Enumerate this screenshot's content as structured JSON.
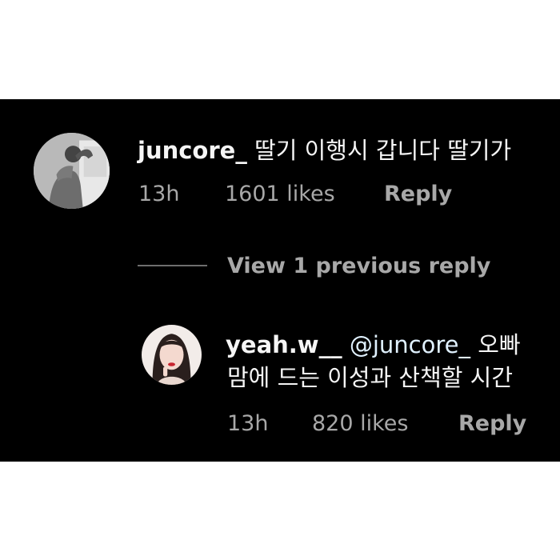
{
  "comments": [
    {
      "username": "juncore_",
      "text": "딸기 이행시 갑니다 딸기가",
      "time": "13h",
      "likes": "1601 likes",
      "reply_label": "Reply",
      "avatar_icon": "profile-photo"
    }
  ],
  "view_previous": "View 1 previous reply",
  "replies": [
    {
      "username": "yeah.w__",
      "mention": "@juncore_",
      "text_line1_after": "오빠",
      "text_line2": "맘에 드는 이성과 산책할 시간",
      "time": "13h",
      "likes": "820 likes",
      "reply_label": "Reply",
      "avatar_icon": "profile-photo"
    }
  ],
  "colors": {
    "background": "#000000",
    "primary_text": "#f5f5f5",
    "secondary_text": "#a8a8a8",
    "mention": "#e0f1ff"
  }
}
